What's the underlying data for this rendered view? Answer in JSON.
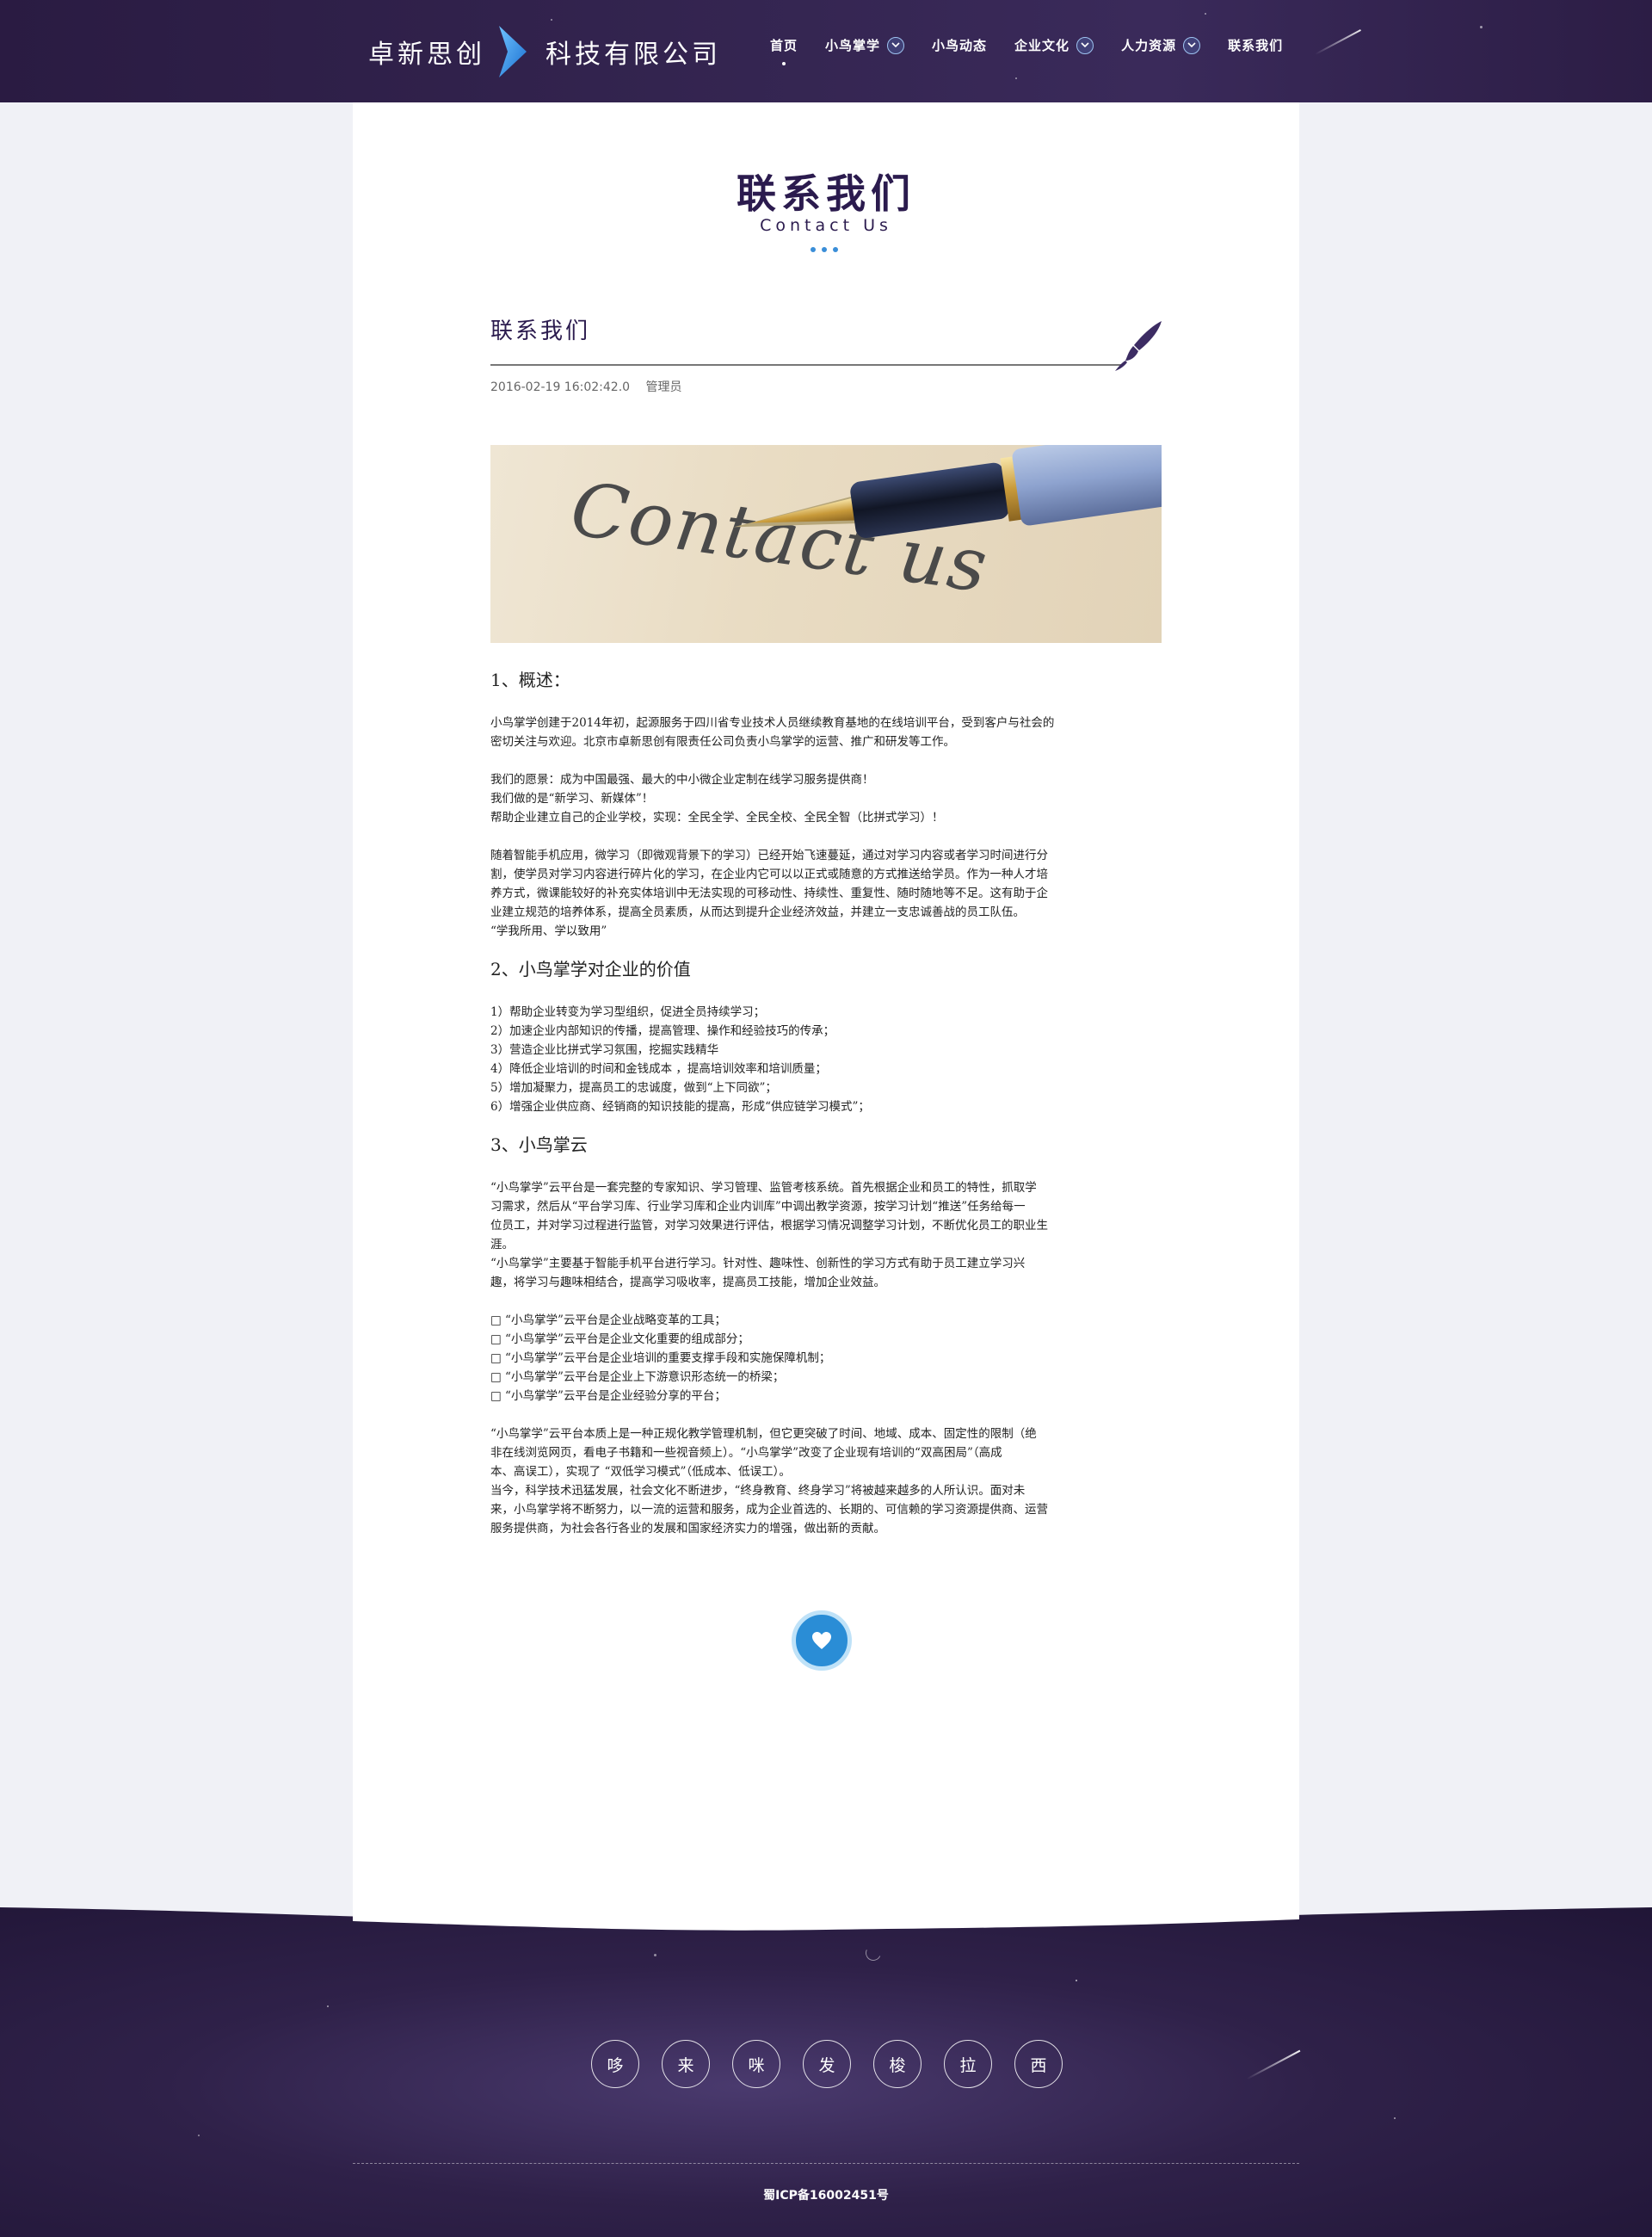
{
  "header": {
    "logo_left": "卓新思创",
    "logo_right": "科技有限公司",
    "nav": [
      {
        "label": "首页",
        "active": true,
        "dropdown": false
      },
      {
        "label": "小鸟掌学",
        "active": false,
        "dropdown": true
      },
      {
        "label": "小鸟动态",
        "active": false,
        "dropdown": false
      },
      {
        "label": "企业文化",
        "active": false,
        "dropdown": true
      },
      {
        "label": "人力资源",
        "active": false,
        "dropdown": true
      },
      {
        "label": "联系我们",
        "active": false,
        "dropdown": false
      }
    ]
  },
  "page": {
    "title": "联系我们",
    "subtitle": "Contact Us"
  },
  "article": {
    "title": "联系我们",
    "date": "2016-02-19 16:02:42.0",
    "author": "管理员",
    "banner_text": "Contact us",
    "sections": [
      {
        "heading": "1、概述：",
        "paragraphs": [
          [
            "小鸟掌学创建于2014年初，起源服务于四川省专业技术人员继续教育基地的在线培训平台，受到客户与社会的",
            "密切关注与欢迎。北京市卓新思创有限责任公司负责小鸟掌学的运营、推广和研发等工作。"
          ],
          [
            "我们的愿景：成为中国最强、最大的中小微企业定制在线学习服务提供商！",
            "我们做的是“新学习、新媒体”！",
            "帮助企业建立自己的企业学校，实现：全民全学、全民全校、全民全智（比拼式学习）！"
          ],
          [
            "随着智能手机应用，微学习（即微观背景下的学习）已经开始飞速蔓延，通过对学习内容或者学习时间进行分",
            "割，使学员对学习内容进行碎片化的学习，在企业内它可以以正式或随意的方式推送给学员。作为一种人才培",
            "养方式，微课能较好的补充实体培训中无法实现的可移动性、持续性、重复性、随时随地等不足。这有助于企",
            "业建立规范的培养体系，提高全员素质，从而达到提升企业经济效益，并建立一支忠诚善战的员工队伍。",
            "“学我所用、学以致用”"
          ]
        ]
      },
      {
        "heading": "2、小鸟掌学对企业的价值",
        "paragraphs": [
          [
            "1）帮助企业转变为学习型组织，促进全员持续学习；",
            "2）加速企业内部知识的传播，提高管理、操作和经验技巧的传承；",
            "3）营造企业比拼式学习氛围，挖掘实践精华",
            "4）降低企业培训的时间和金钱成本 ，提高培训效率和培训质量；",
            "5）增加凝聚力，提高员工的忠诚度，做到“上下同欲”；",
            "6）增强企业供应商、经销商的知识技能的提高，形成“供应链学习模式”；"
          ]
        ]
      },
      {
        "heading": "3、小鸟掌云",
        "paragraphs": [
          [
            "“小鸟掌学”云平台是一套完整的专家知识、学习管理、监管考核系统。首先根据企业和员工的特性，抓取学",
            "习需求，然后从“平台学习库、行业学习库和企业内训库”中调出教学资源，按学习计划“推送”任务给每一",
            "位员工，并对学习过程进行监管，对学习效果进行评估，根据学习情况调整学习计划，不断优化员工的职业生",
            "涯。",
            "“小鸟掌学”主要基于智能手机平台进行学习。针对性、趣味性、创新性的学习方式有助于员工建立学习兴",
            "趣，将学习与趣味相结合，提高学习吸收率，提高员工技能，增加企业效益。"
          ],
          [
            "□ “小鸟掌学”云平台是企业战略变革的工具；",
            "□ “小鸟掌学”云平台是企业文化重要的组成部分；",
            "□ “小鸟掌学”云平台是企业培训的重要支撑手段和实施保障机制；",
            "□ “小鸟掌学”云平台是企业上下游意识形态统一的桥梁；",
            "□ “小鸟掌学”云平台是企业经验分享的平台；"
          ],
          [
            "“小鸟掌学”云平台本质上是一种正规化教学管理机制，但它更突破了时间、地域、成本、固定性的限制（绝",
            "非在线浏览网页，看电子书籍和一些视音频上）。“小鸟掌学”改变了企业现有培训的“双高困局”（高成",
            "本、高误工），实现了 “双低学习模式”（低成本、低误工）。",
            "当今，科学技术迅猛发展，社会文化不断进步，“终身教育、终身学习”将被越来越多的人所认识。面对未",
            "来，小鸟掌学将不断努力，以一流的运营和服务，成为企业首选的、长期的、可信赖的学习资源提供商、运营",
            "服务提供商，为社会各行各业的发展和国家经济实力的增强，做出新的贡献。"
          ]
        ]
      }
    ]
  },
  "footer": {
    "circles": [
      "哆",
      "来",
      "咪",
      "发",
      "梭",
      "拉",
      "西"
    ],
    "icp": "蜀ICP备16002451号"
  },
  "colors": {
    "header_bg": "#33244f",
    "title": "#2b1b4e",
    "accent": "#2a8dd6",
    "footer_bg": "#2f2149"
  },
  "icons": {
    "logo_chevron": "chevron-right-icon",
    "dropdown": "chevron-down-icon",
    "brush": "brush-icon",
    "like": "heart-icon"
  }
}
